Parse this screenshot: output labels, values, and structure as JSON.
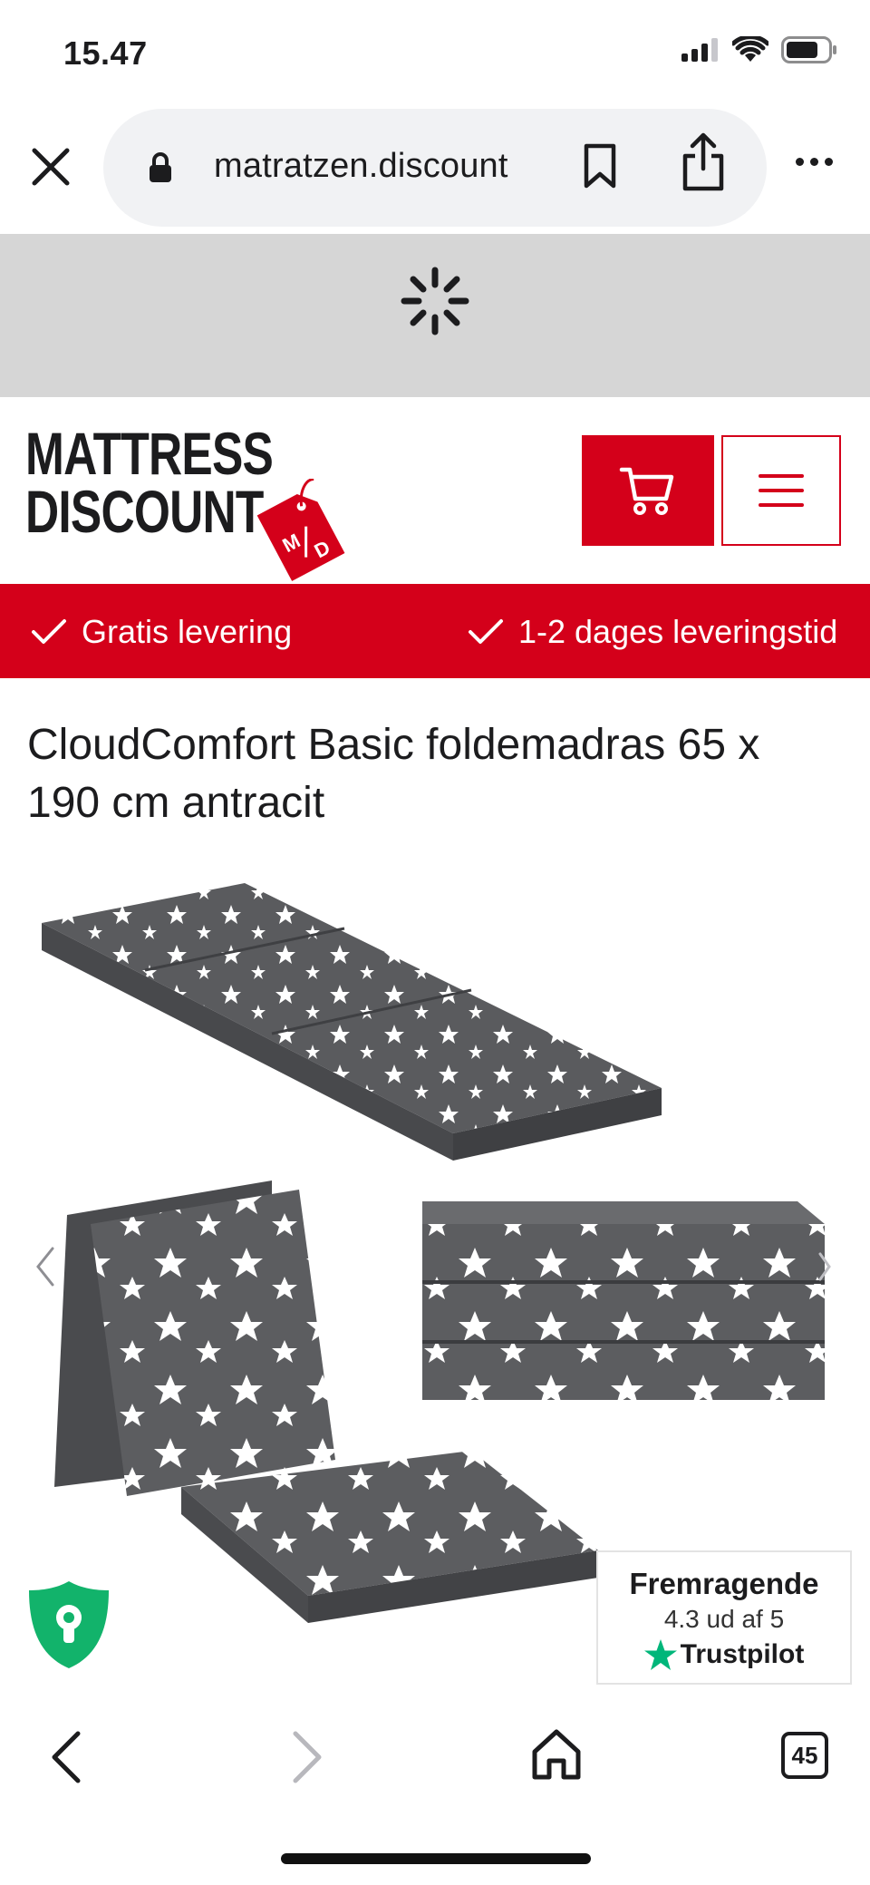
{
  "status_bar": {
    "time": "15.47"
  },
  "browser": {
    "url": "matratzen.discount",
    "tab_count": "45"
  },
  "site": {
    "logo_line1": "MATTRESS",
    "logo_line2": "DISCOUNT",
    "logo_tag": "M/D",
    "brand_color": "#d4001a"
  },
  "usp": [
    {
      "label": "Gratis levering"
    },
    {
      "label": "1-2 dages leveringstid"
    }
  ],
  "product": {
    "title": "CloudComfort Basic foldemadras 65 x 190 cm antracit"
  },
  "trustpilot": {
    "rating_label": "Fremragende",
    "score": "4.3 ud af 5",
    "brand": "Trustpilot"
  },
  "icons": {
    "close": "close-icon",
    "lock": "lock-icon",
    "bookmark": "bookmark-icon",
    "share": "share-icon",
    "cart": "cart-icon",
    "menu": "hamburger-icon",
    "check": "check-icon",
    "shield": "shield-keyhole-icon",
    "star": "star-icon"
  }
}
